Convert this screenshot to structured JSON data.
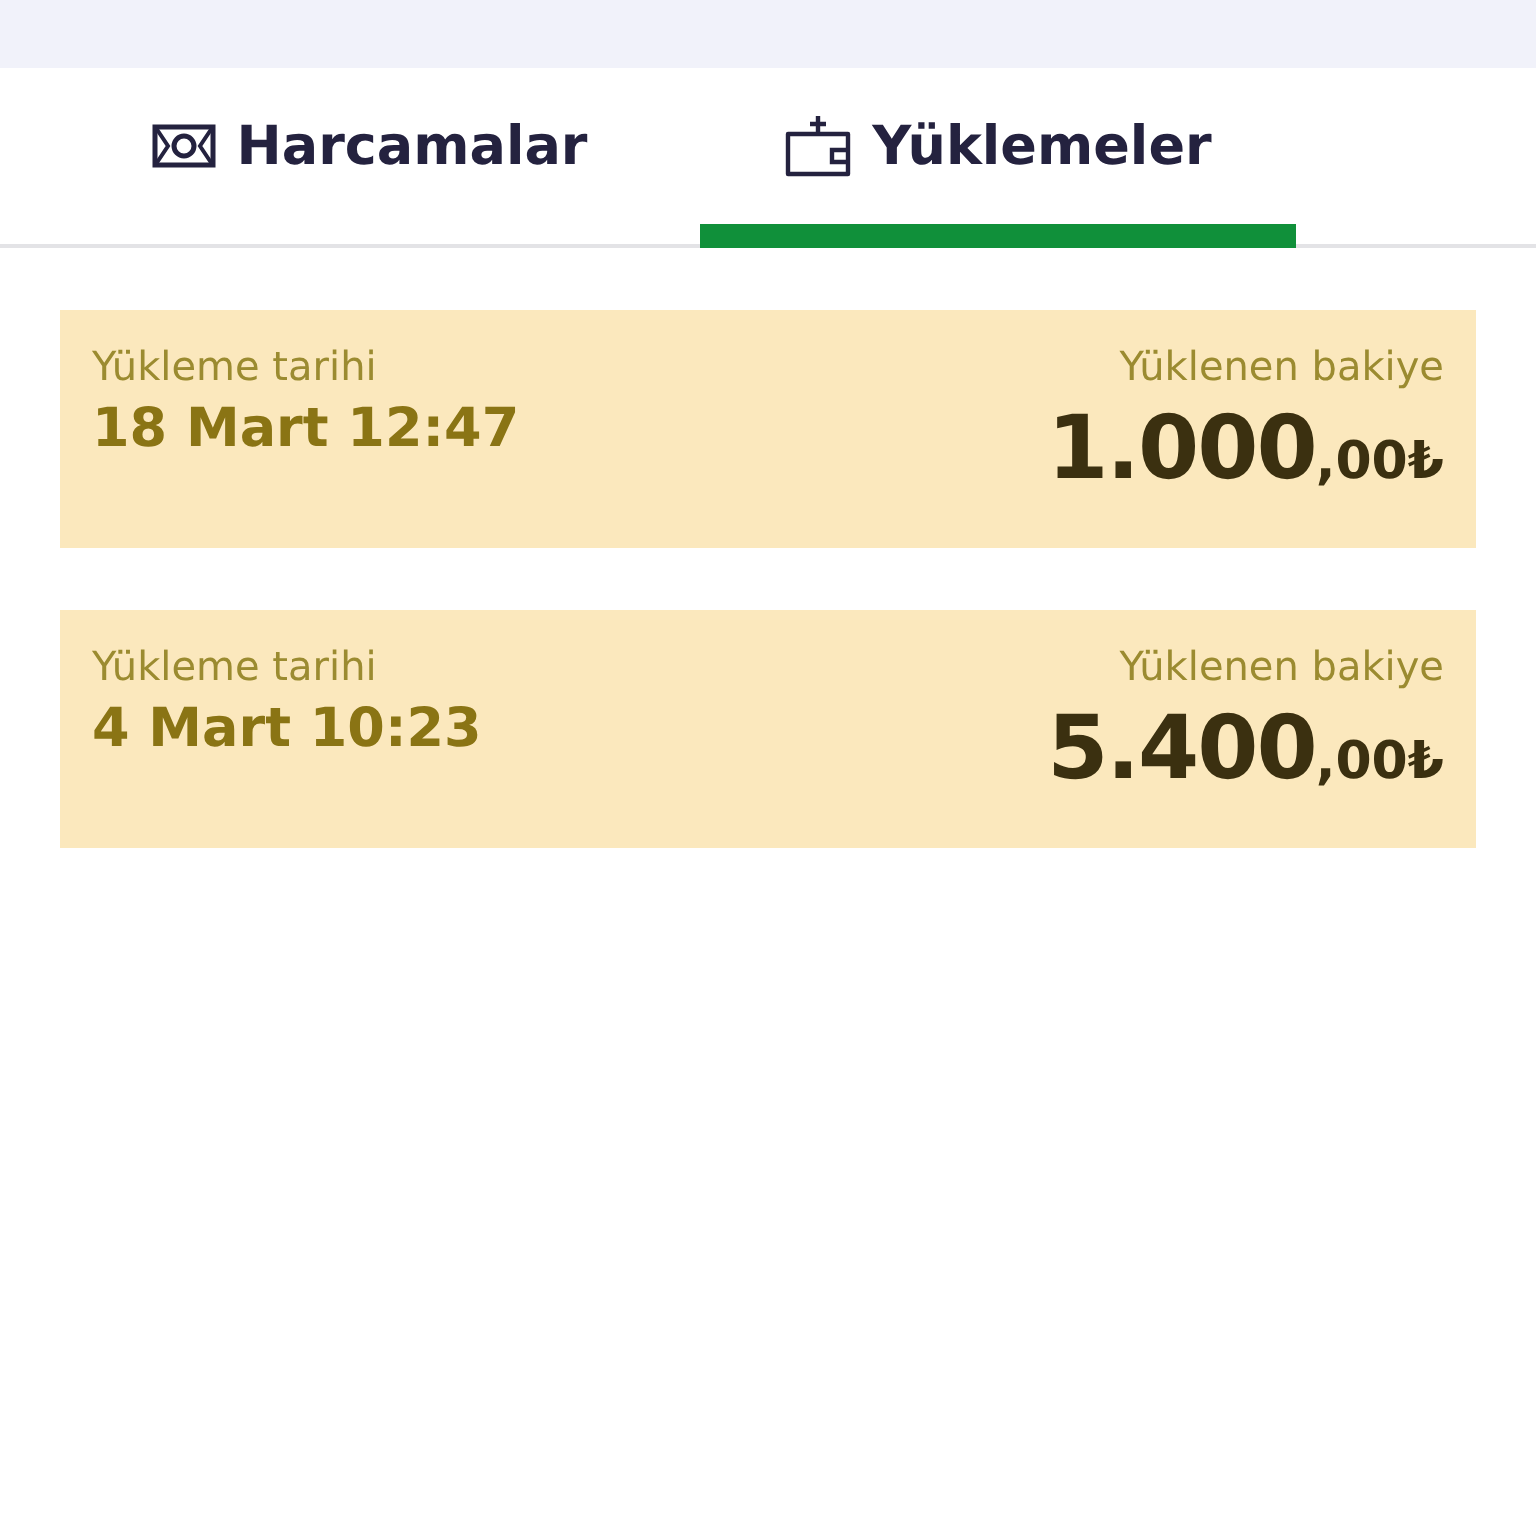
{
  "tabs": [
    {
      "label": "Harcamalar",
      "kind": "cash",
      "selected": false
    },
    {
      "label": "Yüklemeler",
      "kind": "wallet",
      "selected": true
    }
  ],
  "entries": [
    {
      "date_label": "Yükleme tarihi",
      "date": "18 Mart 12:47",
      "amount_label": "Yüklenen bakiye",
      "amount": "1.000",
      "decimals": ",00₺"
    },
    {
      "date_label": "Yükleme tarihi",
      "date": "4 Mart 10:23",
      "amount_label": "Yüklenen bakiye",
      "amount": "5.400",
      "decimals": ",00₺"
    }
  ]
}
